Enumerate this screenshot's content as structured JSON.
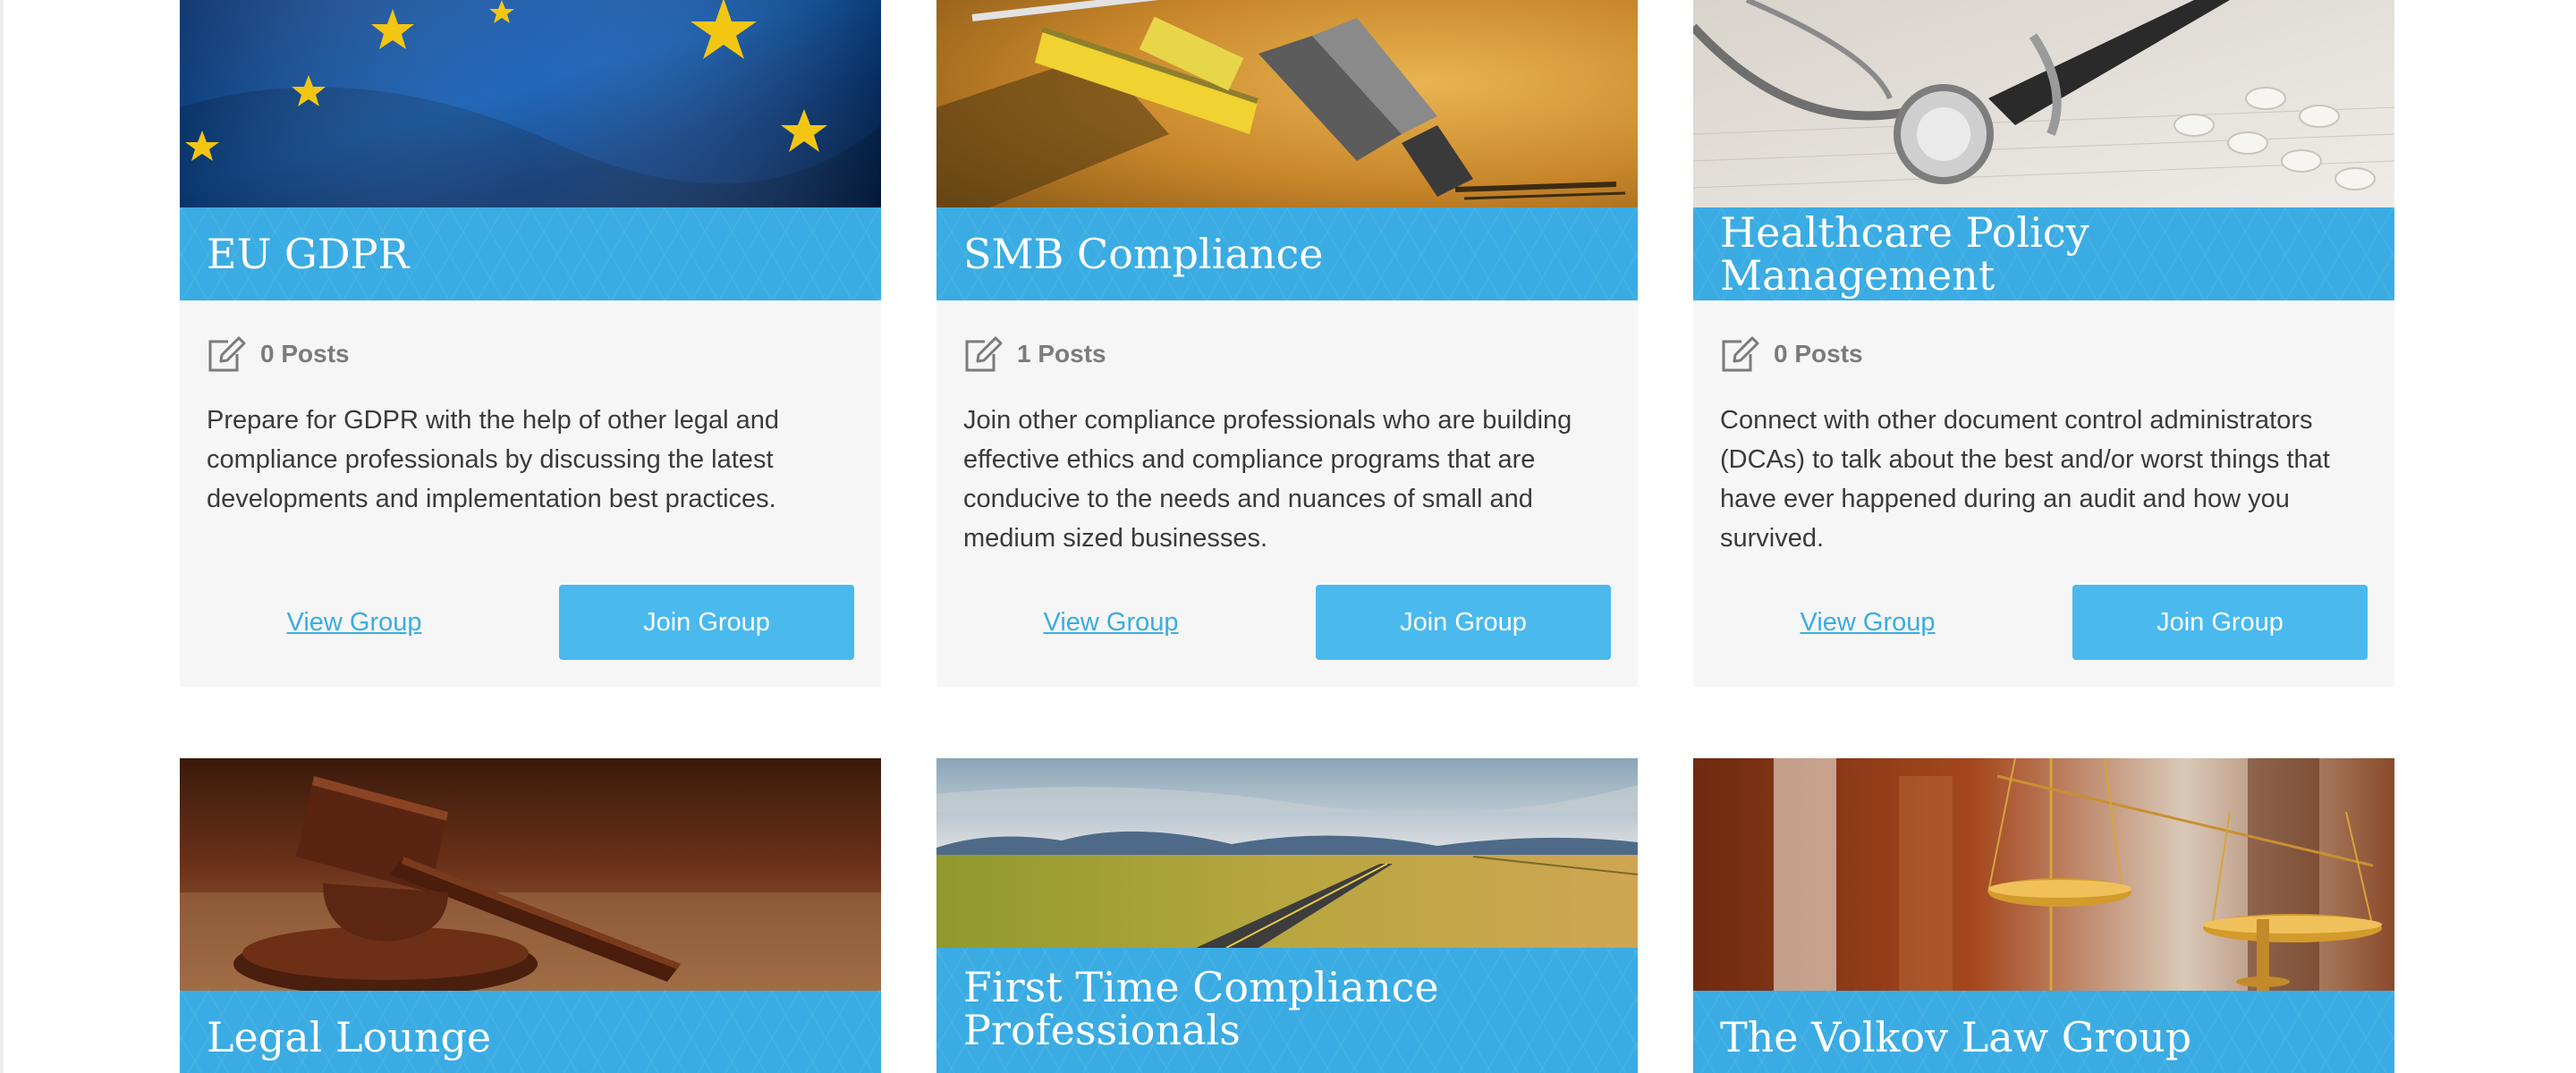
{
  "groups": [
    {
      "title": "EU GDPR",
      "image": "eu-flag-stars",
      "posts": "0 Posts",
      "description": "Prepare for GDPR with the help of other legal and compliance professionals by discussing the latest developments and implementation best practices.",
      "view_label": "View Group",
      "join_label": "Join Group"
    },
    {
      "title": "SMB Compliance",
      "image": "tools-tape-measure-pliers",
      "posts": "1 Posts",
      "description": "Join other compliance professionals who are building effective ethics and compliance programs that are conducive to the needs and nuances of small and medium sized businesses.",
      "view_label": "View Group",
      "join_label": "Join Group"
    },
    {
      "title": "Healthcare Policy Management",
      "image": "stethoscope-pills",
      "posts": "0 Posts",
      "description": "Connect with other document control administrators (DCAs) to talk about the best and/or worst things that have ever happened during an audit and how you survived.",
      "view_label": "View Group",
      "join_label": "Join Group"
    },
    {
      "title": "Legal Lounge",
      "image": "judge-gavel"
    },
    {
      "title": "First Time Compliance Professionals",
      "image": "country-road-landscape"
    },
    {
      "title": "The Volkov Law Group",
      "image": "scales-of-justice"
    }
  ],
  "colors": {
    "banner": "#3aace3",
    "button": "#4ab9ee",
    "link": "#3aace3",
    "card_bg": "#f6f6f6"
  },
  "icons": {
    "posts": "edit-icon"
  }
}
